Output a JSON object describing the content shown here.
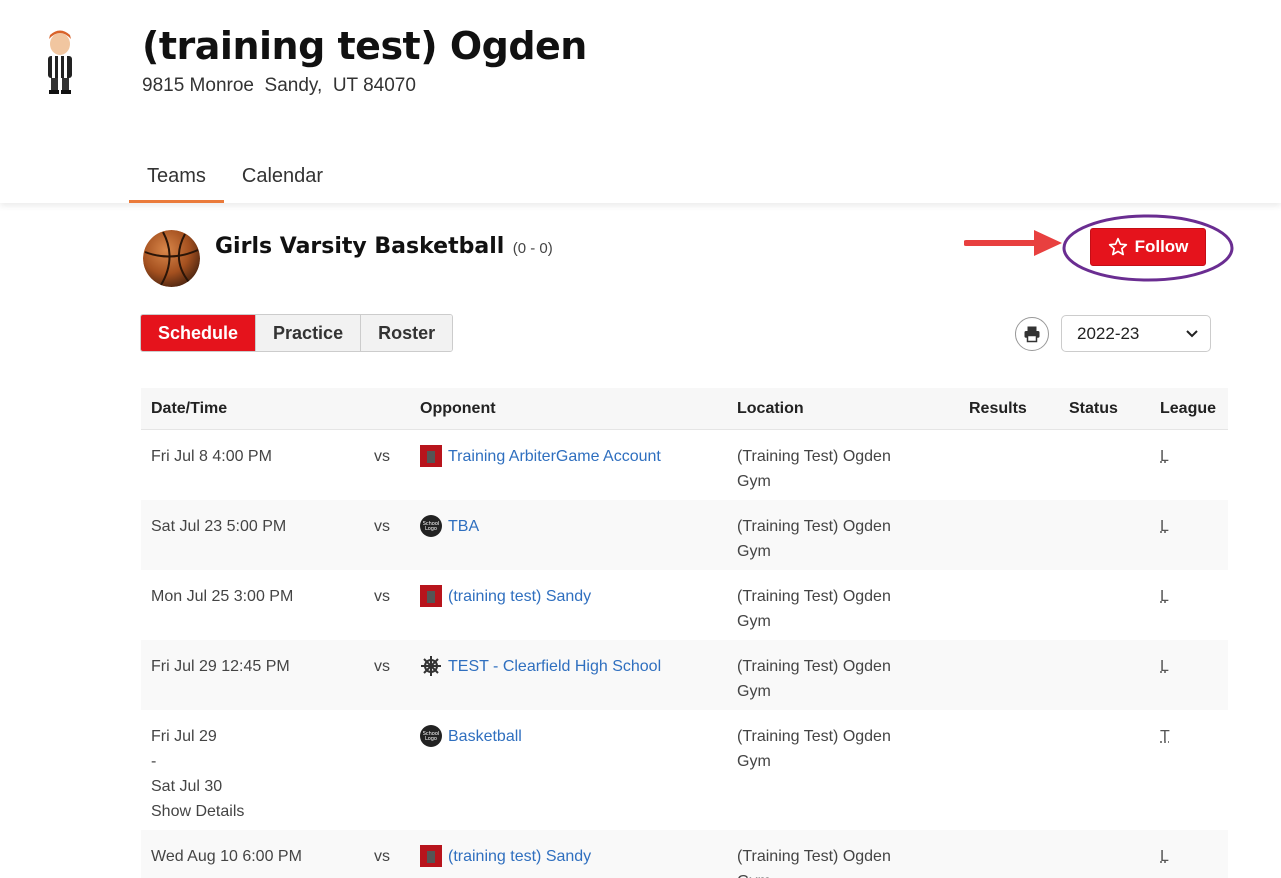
{
  "school": {
    "name": "(training test) Ogden",
    "address": "9815 Monroe  Sandy,  UT 84070"
  },
  "tabs": [
    {
      "label": "Teams",
      "active": true
    },
    {
      "label": "Calendar",
      "active": false
    }
  ],
  "team": {
    "name": "Girls Varsity Basketball",
    "record": "(0 - 0)"
  },
  "follow_label": "Follow",
  "subtabs": [
    {
      "label": "Schedule",
      "active": true
    },
    {
      "label": "Practice",
      "active": false
    },
    {
      "label": "Roster",
      "active": false
    }
  ],
  "season": "2022-23",
  "table": {
    "headers": {
      "datetime": "Date/Time",
      "opponent": "Opponent",
      "location": "Location",
      "results": "Results",
      "status": "Status",
      "league": "League"
    },
    "rows": [
      {
        "date": "Fri Jul 8 4:00 PM",
        "vs": "vs",
        "icon": "red-school-logo-icon",
        "opponent": "Training ArbiterGame Account",
        "location1": "(Training Test) Ogden",
        "location2": "Gym",
        "league": "L"
      },
      {
        "date": "Sat Jul 23 5:00 PM",
        "vs": "vs",
        "icon": "school-logo-placeholder-icon",
        "opponent": "TBA",
        "location1": "(Training Test) Ogden",
        "location2": "Gym",
        "league": "L"
      },
      {
        "date": "Mon Jul 25 3:00 PM",
        "vs": "vs",
        "icon": "red-school-logo-icon",
        "opponent": "(training test) Sandy",
        "location1": "(Training Test) Ogden",
        "location2": "Gym",
        "league": "L"
      },
      {
        "date": "Fri Jul 29 12:45 PM",
        "vs": "vs",
        "icon": "ship-wheel-icon",
        "opponent": "TEST - Clearfield High School",
        "location1": "(Training Test) Ogden",
        "location2": "Gym",
        "league": "L"
      },
      {
        "date": "Fri Jul 29",
        "date2": "-",
        "date3": "Sat Jul 30",
        "details": "Show Details",
        "vs": "",
        "icon": "school-logo-placeholder-icon",
        "opponent": "Basketball",
        "location1": "(Training Test) Ogden",
        "location2": "Gym",
        "league": "T"
      },
      {
        "date": "Wed Aug 10 6:00 PM",
        "vs": "vs",
        "icon": "red-school-logo-icon",
        "opponent": "(training test) Sandy",
        "location1": "(Training Test) Ogden",
        "location2": "Gym",
        "league": "L"
      }
    ]
  },
  "placeholder_logo_text": "School Logo",
  "colors": {
    "accent_red": "#e5131c",
    "tab_underline": "#ea7a3a",
    "link": "#2f6fbf",
    "annotation_purple": "#6a2d91",
    "annotation_arrow": "#e8403f"
  }
}
